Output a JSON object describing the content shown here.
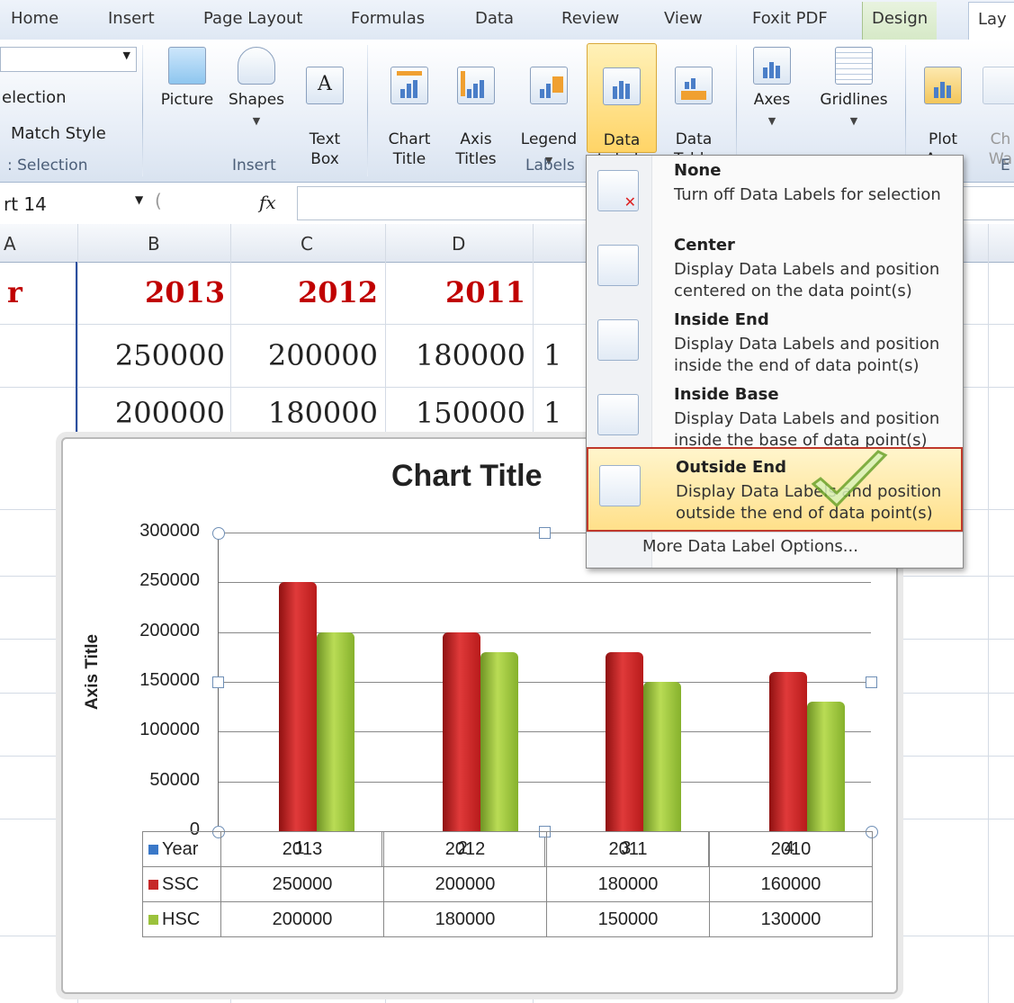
{
  "ribbon_tabs": [
    "Home",
    "Insert",
    "Page Layout",
    "Formulas",
    "Data",
    "Review",
    "View",
    "Foxit PDF",
    "Design",
    "Lay"
  ],
  "ribbon": {
    "selection_items": [
      "election",
      "Match Style"
    ],
    "selection_label": "Selection",
    "insert_buttons": [
      {
        "label": "Picture"
      },
      {
        "label": "Shapes"
      },
      {
        "label": "Text\nBox"
      }
    ],
    "insert_label": "Insert",
    "labels_buttons": [
      {
        "label": "Chart\nTitle"
      },
      {
        "label": "Axis\nTitles"
      },
      {
        "label": "Legend"
      },
      {
        "label": "Data\nLabels"
      },
      {
        "label": "Data\nTable"
      }
    ],
    "labels_label": "Labels",
    "axes_buttons": [
      {
        "label": "Axes"
      },
      {
        "label": "Gridlines"
      }
    ],
    "bg_buttons": [
      {
        "label": "Plot\nArea"
      },
      {
        "label": "Ch\nWa"
      }
    ],
    "bg_label": "E"
  },
  "formula_bar": {
    "name_box": "rt 14",
    "fx": "fx"
  },
  "columns": [
    "A",
    "B",
    "C",
    "D"
  ],
  "sheet": {
    "row1": [
      "r",
      "2013",
      "2012",
      "2011"
    ],
    "row2": [
      "250000",
      "200000",
      "180000",
      "1"
    ],
    "row3": [
      "200000",
      "180000",
      "150000",
      "1"
    ]
  },
  "menu": {
    "items": [
      {
        "title": "None",
        "desc": "Turn off Data Labels for selection"
      },
      {
        "title": "Center",
        "desc": "Display Data Labels and position centered on the data point(s)"
      },
      {
        "title": "Inside End",
        "desc": "Display Data Labels and position inside the end of data point(s)"
      },
      {
        "title": "Inside Base",
        "desc": "Display Data Labels and position inside the base of data point(s)"
      },
      {
        "title": "Outside End",
        "desc": "Display Data Labels and position outside the end of data point(s)"
      }
    ],
    "more": "More Data Label Options..."
  },
  "colors": {
    "ssc": "#c62828",
    "hsc": "#9bc23c",
    "year": "#3a78c8",
    "highlight_border": "#c0392b"
  },
  "chart_data": {
    "type": "bar",
    "title": "Chart Title",
    "ylabel": "Axis Title",
    "xlabel": "",
    "categories": [
      "1",
      "2",
      "3",
      "4"
    ],
    "ylim": [
      0,
      300000
    ],
    "yticks": [
      "300000",
      "250000",
      "200000",
      "150000",
      "100000",
      "50000",
      "0"
    ],
    "grid": true,
    "series": [
      {
        "name": "Year",
        "values": [
          2013,
          2012,
          2011,
          2010
        ]
      },
      {
        "name": "SSC",
        "values": [
          250000,
          200000,
          180000,
          160000
        ]
      },
      {
        "name": "HSC",
        "values": [
          200000,
          180000,
          150000,
          130000
        ]
      }
    ],
    "data_table": {
      "rows": [
        {
          "name": "Year",
          "values": [
            "2013",
            "2012",
            "2011",
            "2010"
          ]
        },
        {
          "name": "SSC",
          "values": [
            "250000",
            "200000",
            "180000",
            "160000"
          ]
        },
        {
          "name": "HSC",
          "values": [
            "200000",
            "180000",
            "150000",
            "130000"
          ]
        }
      ]
    }
  }
}
